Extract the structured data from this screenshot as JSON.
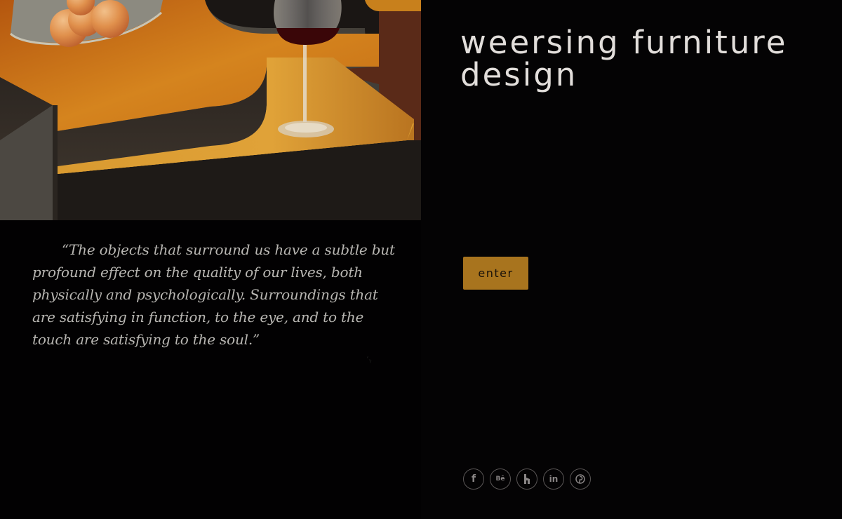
{
  "site": {
    "title": "weersing furniture design"
  },
  "quote": {
    "text": "“The objects that surround us have a subtle but profound effect on the quality of our lives, both physically and psychologically.  Surroundings that are satisfying in function, to the eye, and to the touch are satisfying to the soul.”"
  },
  "enter_button": {
    "label": "enter"
  },
  "social": [
    {
      "name": "facebook",
      "icon": "facebook-icon",
      "glyph": "f"
    },
    {
      "name": "behance",
      "icon": "behance-icon",
      "glyph": "Bē"
    },
    {
      "name": "houzz",
      "icon": "houzz-icon",
      "glyph": ""
    },
    {
      "name": "linkedin",
      "icon": "linkedin-icon",
      "glyph": "in"
    },
    {
      "name": "pinterest",
      "icon": "pinterest-icon",
      "glyph": ""
    }
  ],
  "colors": {
    "background": "#040304",
    "title": "#e2dedb",
    "accent": "#a8741e",
    "quote": "#b8b6b2",
    "wood": "#c9791c",
    "social_border": "#5a5656"
  }
}
